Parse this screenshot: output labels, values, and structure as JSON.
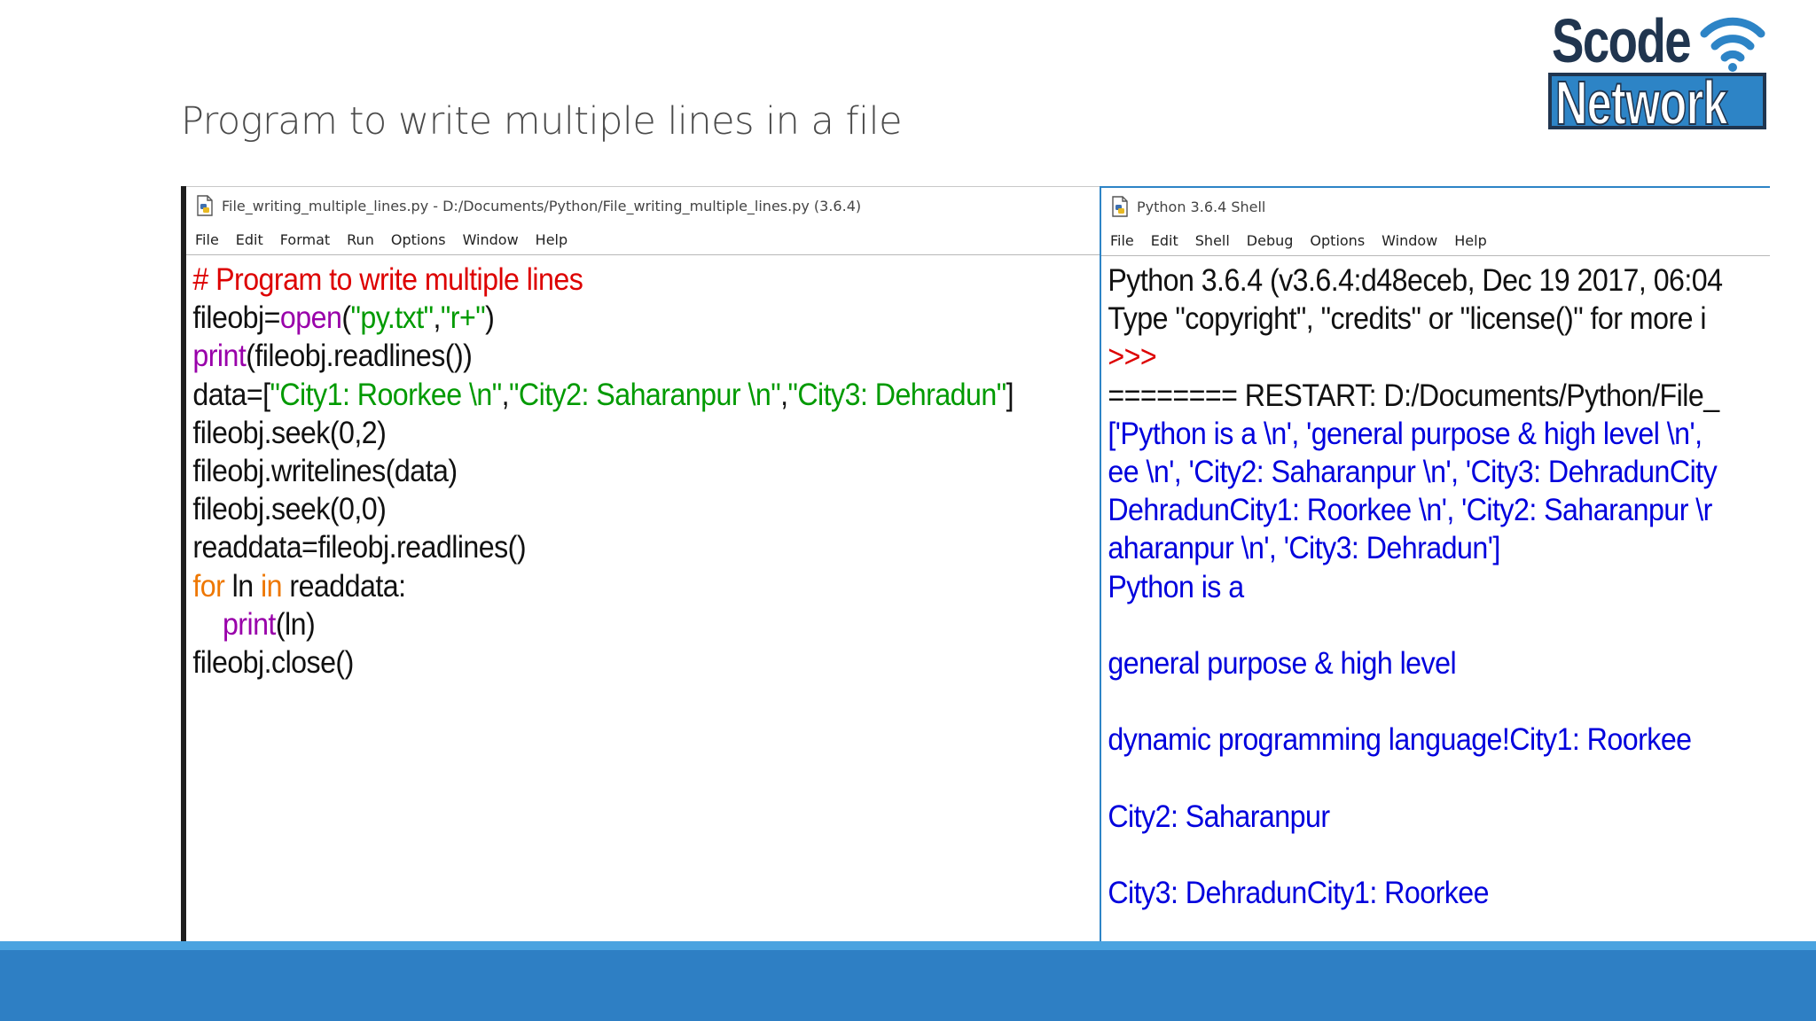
{
  "slide": {
    "title": "Program to write multiple lines in a file"
  },
  "logo": {
    "line1": "Scode",
    "line2": "Network",
    "icon": "wifi-icon"
  },
  "editor": {
    "title": "File_writing_multiple_lines.py - D:/Documents/Python/File_writing_multiple_lines.py (3.6.4)",
    "menu": [
      "File",
      "Edit",
      "Format",
      "Run",
      "Options",
      "Window",
      "Help"
    ],
    "code": [
      [
        [
          "c-comment",
          "# Program to write multiple lines"
        ]
      ],
      [
        [
          "",
          "fileobj="
        ],
        [
          "c-builtin",
          "open"
        ],
        [
          "",
          "("
        ],
        [
          "c-string",
          "\"py.txt\""
        ],
        [
          "",
          ","
        ],
        [
          "c-string",
          "\"r+\""
        ],
        [
          "",
          ")"
        ]
      ],
      [
        [
          "c-builtin",
          "print"
        ],
        [
          "",
          "(fileobj.readlines())"
        ]
      ],
      [
        [
          "",
          "data=["
        ],
        [
          "c-string",
          "\"City1: Roorkee \\n\""
        ],
        [
          "",
          ","
        ],
        [
          "c-string",
          "\"City2: Saharanpur \\n\""
        ],
        [
          "",
          ","
        ],
        [
          "c-string",
          "\"City3: Dehradun\""
        ],
        [
          "",
          "]"
        ]
      ],
      [
        [
          "",
          "fileobj.seek(0,2)"
        ]
      ],
      [
        [
          "",
          "fileobj.writelines(data)"
        ]
      ],
      [
        [
          "",
          "fileobj.seek(0,0)"
        ]
      ],
      [
        [
          "",
          "readdata=fileobj.readlines()"
        ]
      ],
      [
        [
          "c-keyword",
          "for"
        ],
        [
          "",
          " ln "
        ],
        [
          "c-keyword",
          "in"
        ],
        [
          "",
          " readdata:"
        ]
      ],
      [
        [
          "",
          "    "
        ],
        [
          "c-builtin",
          "print"
        ],
        [
          "",
          "(ln)"
        ]
      ],
      [
        [
          "",
          "fileobj.close()"
        ]
      ]
    ]
  },
  "shell": {
    "title": "Python 3.6.4 Shell",
    "menu": [
      "File",
      "Edit",
      "Shell",
      "Debug",
      "Options",
      "Window",
      "Help"
    ],
    "lines": [
      [
        [
          "",
          "Python 3.6.4 (v3.6.4:d48eceb, Dec 19 2017, 06:04"
        ]
      ],
      [
        [
          "",
          "Type \"copyright\", \"credits\" or \"license()\" for more i"
        ]
      ],
      [
        [
          "c-comment",
          ">>>"
        ]
      ],
      [
        [
          "",
          "======== RESTART: D:/Documents/Python/File_"
        ]
      ],
      [
        [
          "c-out",
          "['Python is a \\n', 'general purpose & high level \\n',"
        ]
      ],
      [
        [
          "c-out",
          "ee \\n', 'City2: Saharanpur \\n', 'City3: DehradunCity"
        ]
      ],
      [
        [
          "c-out",
          "DehradunCity1: Roorkee \\n', 'City2: Saharanpur \\r"
        ]
      ],
      [
        [
          "c-out",
          "aharanpur \\n', 'City3: Dehradun']"
        ]
      ],
      [
        [
          "c-out",
          "Python is a"
        ]
      ],
      [
        [
          "c-out",
          ""
        ]
      ],
      [
        [
          "c-out",
          "general purpose & high level"
        ]
      ],
      [
        [
          "c-out",
          ""
        ]
      ],
      [
        [
          "c-out",
          "dynamic programming language!City1: Roorkee"
        ]
      ],
      [
        [
          "c-out",
          ""
        ]
      ],
      [
        [
          "c-out",
          "City2: Saharanpur"
        ]
      ],
      [
        [
          "c-out",
          ""
        ]
      ],
      [
        [
          "c-out",
          "City3: DehradunCity1: Roorkee"
        ]
      ]
    ]
  },
  "colors": {
    "comment": "#dd0000",
    "builtin": "#9900aa",
    "string": "#009a00",
    "keyword": "#ee7700",
    "output": "#0000dd",
    "footer": "#2e7fc4",
    "accent": "#4aa3e0"
  }
}
